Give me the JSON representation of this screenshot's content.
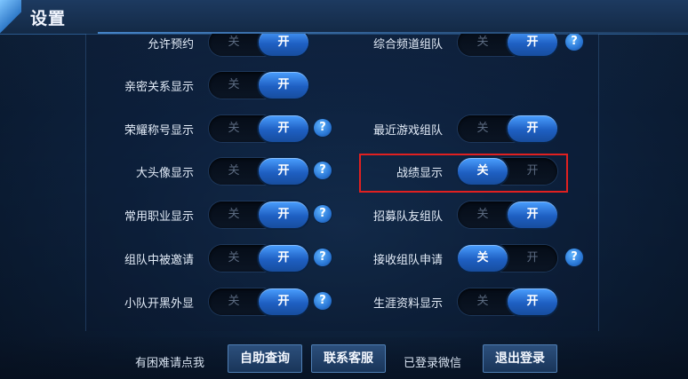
{
  "header": {
    "title": "设置"
  },
  "labels": {
    "off": "关",
    "on": "开",
    "help": "?"
  },
  "left_settings": [
    {
      "label": "允许预约",
      "state": "on",
      "help": false
    },
    {
      "label": "亲密关系显示",
      "state": "on",
      "help": false
    },
    {
      "label": "荣耀称号显示",
      "state": "on",
      "help": true
    },
    {
      "label": "大头像显示",
      "state": "on",
      "help": true
    },
    {
      "label": "常用职业显示",
      "state": "on",
      "help": true
    },
    {
      "label": "组队中被邀请",
      "state": "on",
      "help": true
    },
    {
      "label": "小队开黑外显",
      "state": "on",
      "help": true
    }
  ],
  "right_settings": [
    {
      "label": "综合频道组队",
      "state": "on",
      "help": true
    },
    {
      "label": "最近游戏组队",
      "state": "on",
      "help": false
    },
    {
      "label": "战绩显示",
      "state": "off",
      "help": false,
      "highlighted": true
    },
    {
      "label": "招募队友组队",
      "state": "on",
      "help": false
    },
    {
      "label": "接收组队申请",
      "state": "off",
      "help": true
    },
    {
      "label": "生涯资料显示",
      "state": "on",
      "help": false
    }
  ],
  "footer": {
    "help_prompt": "有困难请点我",
    "self_service_button": "自助查询",
    "contact_button": "联系客服",
    "login_status": "已登录微信",
    "logout_button": "退出登录"
  },
  "colors": {
    "accent": "#2a7be0",
    "highlight_border": "#e02020"
  }
}
